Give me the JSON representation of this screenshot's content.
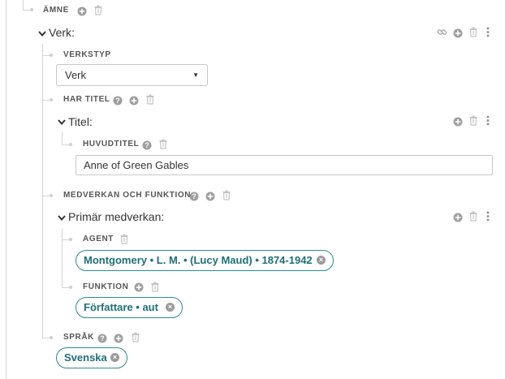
{
  "amne": {
    "label": "ÄMNE"
  },
  "verk": {
    "heading": "Verk:",
    "verkstyp": {
      "label": "VERKSTYP",
      "value": "Verk"
    },
    "har_titel": {
      "label": "HAR TITEL",
      "titel": {
        "heading": "Titel:",
        "huvudtitel": {
          "label": "HUVUDTITEL",
          "value": "Anne of Green Gables"
        }
      }
    },
    "medverkan": {
      "label": "MEDVERKAN OCH FUNKTION",
      "primar": {
        "heading": "Primär medverkan:",
        "agent": {
          "label": "AGENT",
          "value": "Montgomery • L. M. • (Lucy Maud) • 1874-1942"
        },
        "funktion": {
          "label": "FUNKTION",
          "value": "Författare • aut"
        }
      }
    },
    "sprak": {
      "label": "SPRÅK",
      "value": "Svenska"
    }
  },
  "colors": {
    "accent": "#2a8c95",
    "icon": "#9e9e9e",
    "line": "#d4d4d4"
  }
}
